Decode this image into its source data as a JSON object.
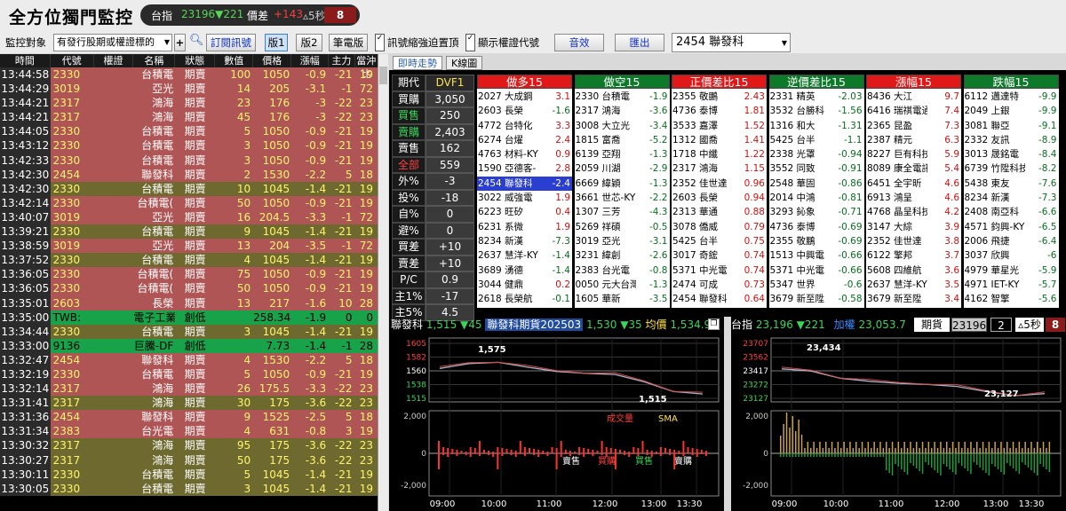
{
  "app_title": "全方位獨門監控",
  "index_pill": {
    "label": "台指",
    "value": "23196▼221",
    "spread_label": "價差",
    "spread": "+143",
    "interval": "5秒",
    "countdown": "8"
  },
  "toolbar": {
    "monitor_label": "監控對象",
    "monitor_select": "有發行股期或權證標的",
    "subscribe": "訂閱訊號",
    "v1": "版1",
    "v2": "版2",
    "notebook": "筆電版",
    "chk1": "訊號縮強迫置頂",
    "chk2": "顯示權證代號",
    "sound": "音效",
    "export": "匯出",
    "stock_select": "2454 聯發科"
  },
  "table": {
    "headers": [
      "時間",
      "代號",
      "權證",
      "名稱",
      "狀態",
      "數值",
      "價格",
      "漲幅",
      "主力",
      "當沖比"
    ],
    "rows": [
      {
        "t": "13:44:58",
        "code": "2330",
        "rt": "",
        "name": "台積電",
        "st": "期賣",
        "qty": "100",
        "pr": "1050",
        "ch": "-0.9",
        "mf": "-21",
        "bs": "19",
        "c": "red"
      },
      {
        "t": "13:44:29",
        "code": "3019",
        "rt": "",
        "name": "亞光",
        "st": "期賣",
        "qty": "14",
        "pr": "205",
        "ch": "-3.1",
        "mf": "-1",
        "bs": "72",
        "c": "red"
      },
      {
        "t": "13:44:21",
        "code": "2317",
        "rt": "",
        "name": "鴻海",
        "st": "期賣",
        "qty": "23",
        "pr": "176",
        "ch": "-3",
        "mf": "-22",
        "bs": "23",
        "c": "red"
      },
      {
        "t": "13:44:21",
        "code": "2317",
        "rt": "",
        "name": "鴻海",
        "st": "期賣",
        "qty": "45",
        "pr": "176",
        "ch": "-3",
        "mf": "-22",
        "bs": "23",
        "c": "red"
      },
      {
        "t": "13:44:05",
        "code": "2330",
        "rt": "",
        "name": "台積電",
        "st": "期賣",
        "qty": "5",
        "pr": "1050",
        "ch": "-0.9",
        "mf": "-21",
        "bs": "19",
        "c": "red"
      },
      {
        "t": "13:43:12",
        "code": "2330",
        "rt": "",
        "name": "台積電",
        "st": "期賣",
        "qty": "3",
        "pr": "1050",
        "ch": "-0.9",
        "mf": "-21",
        "bs": "19",
        "c": "red"
      },
      {
        "t": "13:42:33",
        "code": "2330",
        "rt": "",
        "name": "台積電",
        "st": "期賣",
        "qty": "3",
        "pr": "1050",
        "ch": "-0.9",
        "mf": "-21",
        "bs": "19",
        "c": "red"
      },
      {
        "t": "13:42:30",
        "code": "2454",
        "rt": "",
        "name": "聯發科",
        "st": "期賣",
        "qty": "2",
        "pr": "1530",
        "ch": "-2.2",
        "mf": "5",
        "bs": "18",
        "c": "red"
      },
      {
        "t": "13:42:30",
        "code": "2330",
        "rt": "",
        "name": "台積電",
        "st": "期賣",
        "qty": "10",
        "pr": "1045",
        "ch": "-1.4",
        "mf": "-21",
        "bs": "19",
        "c": "olive"
      },
      {
        "t": "13:42:14",
        "code": "2330",
        "rt": "",
        "name": "台積電(",
        "st": "期賣",
        "qty": "50",
        "pr": "1050",
        "ch": "-0.9",
        "mf": "-21",
        "bs": "19",
        "c": "red"
      },
      {
        "t": "13:40:07",
        "code": "3019",
        "rt": "",
        "name": "亞光",
        "st": "期賣",
        "qty": "16",
        "pr": "204.5",
        "ch": "-3.3",
        "mf": "-1",
        "bs": "72",
        "c": "red"
      },
      {
        "t": "13:39:21",
        "code": "2330",
        "rt": "",
        "name": "台積電",
        "st": "期賣",
        "qty": "9",
        "pr": "1045",
        "ch": "-1.4",
        "mf": "-21",
        "bs": "19",
        "c": "olive"
      },
      {
        "t": "13:38:59",
        "code": "3019",
        "rt": "",
        "name": "亞光",
        "st": "期賣",
        "qty": "13",
        "pr": "204",
        "ch": "-3.5",
        "mf": "-1",
        "bs": "72",
        "c": "red"
      },
      {
        "t": "13:37:52",
        "code": "2330",
        "rt": "",
        "name": "台積電",
        "st": "期賣",
        "qty": "4",
        "pr": "1045",
        "ch": "-1.4",
        "mf": "-21",
        "bs": "19",
        "c": "olive"
      },
      {
        "t": "13:36:05",
        "code": "2330",
        "rt": "",
        "name": "台積電(",
        "st": "期賣",
        "qty": "75",
        "pr": "1050",
        "ch": "-0.9",
        "mf": "-21",
        "bs": "19",
        "c": "red"
      },
      {
        "t": "13:36:05",
        "code": "2330",
        "rt": "",
        "name": "台積電(",
        "st": "期賣",
        "qty": "50",
        "pr": "1050",
        "ch": "-0.9",
        "mf": "-21",
        "bs": "19",
        "c": "red"
      },
      {
        "t": "13:35:01",
        "code": "2603",
        "rt": "",
        "name": "長榮",
        "st": "期賣",
        "qty": "13",
        "pr": "217",
        "ch": "-1.6",
        "mf": "10",
        "bs": "28",
        "c": "red"
      },
      {
        "t": "13:35:00",
        "code": "TWB:",
        "rt": "",
        "name": "電子工業",
        "st": "創低",
        "qty": "",
        "pr": "258.34",
        "ch": "-1.9",
        "mf": "0",
        "bs": "0",
        "c": "green"
      },
      {
        "t": "13:34:44",
        "code": "2330",
        "rt": "",
        "name": "台積電",
        "st": "期賣",
        "qty": "3",
        "pr": "1045",
        "ch": "-1.4",
        "mf": "-21",
        "bs": "19",
        "c": "olive"
      },
      {
        "t": "13:33:00",
        "code": "9136",
        "rt": "",
        "name": "巨騰-DF",
        "st": "創低",
        "qty": "",
        "pr": "7.73",
        "ch": "-1.4",
        "mf": "-1",
        "bs": "28",
        "c": "green"
      },
      {
        "t": "13:32:47",
        "code": "2454",
        "rt": "",
        "name": "聯發科",
        "st": "期賣",
        "qty": "4",
        "pr": "1530",
        "ch": "-2.2",
        "mf": "5",
        "bs": "18",
        "c": "red"
      },
      {
        "t": "13:32:19",
        "code": "2330",
        "rt": "",
        "name": "台積電",
        "st": "期賣",
        "qty": "5",
        "pr": "1050",
        "ch": "-0.9",
        "mf": "-21",
        "bs": "19",
        "c": "red"
      },
      {
        "t": "13:32:14",
        "code": "2317",
        "rt": "",
        "name": "鴻海",
        "st": "期賣",
        "qty": "26",
        "pr": "175.5",
        "ch": "-3.3",
        "mf": "-22",
        "bs": "23",
        "c": "red"
      },
      {
        "t": "13:31:41",
        "code": "2317",
        "rt": "",
        "name": "鴻海",
        "st": "期賣",
        "qty": "30",
        "pr": "175",
        "ch": "-3.6",
        "mf": "-22",
        "bs": "23",
        "c": "olive"
      },
      {
        "t": "13:31:36",
        "code": "2454",
        "rt": "",
        "name": "聯發科",
        "st": "期賣",
        "qty": "9",
        "pr": "1525",
        "ch": "-2.5",
        "mf": "5",
        "bs": "18",
        "c": "red"
      },
      {
        "t": "13:31:34",
        "code": "2383",
        "rt": "",
        "name": "台光電",
        "st": "期賣",
        "qty": "4",
        "pr": "631",
        "ch": "-0.8",
        "mf": "3",
        "bs": "19",
        "c": "red"
      },
      {
        "t": "13:30:32",
        "code": "2317",
        "rt": "",
        "name": "鴻海",
        "st": "期賣",
        "qty": "95",
        "pr": "175",
        "ch": "-3.6",
        "mf": "-22",
        "bs": "23",
        "c": "olive"
      },
      {
        "t": "13:30:27",
        "code": "2317",
        "rt": "",
        "name": "鴻海",
        "st": "期賣",
        "qty": "50",
        "pr": "175",
        "ch": "-3.6",
        "mf": "-22",
        "bs": "23",
        "c": "olive"
      },
      {
        "t": "13:30:11",
        "code": "2330",
        "rt": "",
        "name": "台積電",
        "st": "期賣",
        "qty": "5",
        "pr": "1045",
        "ch": "-1.4",
        "mf": "-21",
        "bs": "19",
        "c": "olive"
      },
      {
        "t": "13:30:05",
        "code": "2330",
        "rt": "",
        "name": "台積電",
        "st": "期賣",
        "qty": "3",
        "pr": "1045",
        "ch": "-1.4",
        "mf": "-21",
        "bs": "19",
        "c": "olive"
      }
    ]
  },
  "tabs": [
    "即時走勢",
    "K線圖"
  ],
  "metrics": [
    {
      "l": "期代",
      "v": "DVF1",
      "lc": "#fff",
      "vc": "#ffe24a"
    },
    {
      "l": "買購",
      "v": "3,050",
      "lc": "#fff",
      "vc": "#fff"
    },
    {
      "l": "買售",
      "v": "250",
      "lc": "#3bd45a",
      "vc": "#fff"
    },
    {
      "l": "賣購",
      "v": "2,403",
      "lc": "#3bd45a",
      "vc": "#fff"
    },
    {
      "l": "賣售",
      "v": "162",
      "lc": "#fff",
      "vc": "#fff"
    },
    {
      "l": "全部",
      "v": "559",
      "lc": "#ff4040",
      "vc": "#fff"
    },
    {
      "l": "外%",
      "v": "-3",
      "lc": "#fff",
      "vc": "#fff"
    },
    {
      "l": "投%",
      "v": "-18",
      "lc": "#fff",
      "vc": "#fff"
    },
    {
      "l": "自%",
      "v": "0",
      "lc": "#fff",
      "vc": "#fff"
    },
    {
      "l": "避%",
      "v": "0",
      "lc": "#fff",
      "vc": "#fff"
    },
    {
      "l": "買差",
      "v": "+10",
      "lc": "#fff",
      "vc": "#fff"
    },
    {
      "l": "賣差",
      "v": "+10",
      "lc": "#fff",
      "vc": "#fff"
    },
    {
      "l": "P/C",
      "v": "0.9",
      "lc": "#fff",
      "vc": "#fff"
    },
    {
      "l": "主1%",
      "v": "-17",
      "lc": "#fff",
      "vc": "#fff"
    },
    {
      "l": "主5%",
      "v": "4.5",
      "lc": "#fff",
      "vc": "#fff"
    }
  ],
  "rankings": [
    {
      "title": "做多15",
      "hc": "#e01818",
      "rows": [
        [
          "2027 大成鋼",
          "3.1"
        ],
        [
          "2603 長榮",
          "-1.6"
        ],
        [
          "4772 台特化",
          "3.3"
        ],
        [
          "6274 台燿",
          "2.4"
        ],
        [
          "4763 材料-KY",
          "0.9"
        ],
        [
          "1590 亞德客-",
          "2.8"
        ],
        [
          "2454 聯發科",
          "-2.4"
        ],
        [
          "3022 威強電",
          "1.9"
        ],
        [
          "6223 旺矽",
          "0.4"
        ],
        [
          "6231 系微",
          "1.9"
        ],
        [
          "8234 新漢",
          "-7.3"
        ],
        [
          "2637 慧洋-KY",
          "-1.4"
        ],
        [
          "3689 湧德",
          "-1.4"
        ],
        [
          "3044 健鼎",
          "0.2"
        ],
        [
          "2618 長榮航",
          "-0.1"
        ]
      ],
      "sel": 6
    },
    {
      "title": "做空15",
      "hc": "#0d7a2a",
      "rows": [
        [
          "2330 台積電",
          "-1.9"
        ],
        [
          "2317 鴻海",
          "-3.6"
        ],
        [
          "3008 大立光",
          "-3.4"
        ],
        [
          "1815 富喬",
          "-5.2"
        ],
        [
          "6139 亞翔",
          "-1.3"
        ],
        [
          "2059 川湖",
          "-2.9"
        ],
        [
          "6669 緯穎",
          "-1.3"
        ],
        [
          "3661 世芯-KY",
          "-2.2"
        ],
        [
          "1307 三芳",
          "-4.3"
        ],
        [
          "5269 祥碩",
          "-0.5"
        ],
        [
          "3019 亞光",
          "-3.1"
        ],
        [
          "3231 緯創",
          "-2.6"
        ],
        [
          "2383 台光電",
          "-0.8"
        ],
        [
          "0050 元大台灣",
          "-1.3"
        ],
        [
          "1605 華新",
          "-3.5"
        ]
      ],
      "sel": -1
    },
    {
      "title": "正價差比15",
      "hc": "#e01818",
      "rows": [
        [
          "2355 敬鵬",
          "2.43"
        ],
        [
          "4736 泰博",
          "1.81"
        ],
        [
          "3533 嘉澤",
          "1.52"
        ],
        [
          "1312 國喬",
          "1.41"
        ],
        [
          "1718 中纖",
          "1.22"
        ],
        [
          "2317 鴻海",
          "1.15"
        ],
        [
          "2352 佳世達",
          "0.96"
        ],
        [
          "2603 長榮",
          "0.94"
        ],
        [
          "2313 華通",
          "0.88"
        ],
        [
          "3078 僑威",
          "0.79"
        ],
        [
          "5425 台半",
          "0.75"
        ],
        [
          "3017 奇鋐",
          "0.74"
        ],
        [
          "5371 中光電",
          "0.74"
        ],
        [
          "2474 可成",
          "0.73"
        ],
        [
          "2454 聯發科",
          "0.64"
        ]
      ],
      "sel": -1
    },
    {
      "title": "逆價差比15",
      "hc": "#0d7a2a",
      "rows": [
        [
          "2331 精英",
          "-2.03"
        ],
        [
          "3532 台勝科",
          "-1.56"
        ],
        [
          "1316 和大",
          "-1.31"
        ],
        [
          "5425 台半",
          "-1.1"
        ],
        [
          "2338 光罩",
          "-0.94"
        ],
        [
          "3552 同致",
          "-0.91"
        ],
        [
          "2548 華固",
          "-0.86"
        ],
        [
          "2014 中鴻",
          "-0.81"
        ],
        [
          "3293 鈊象",
          "-0.71"
        ],
        [
          "4736 泰博",
          "-0.69"
        ],
        [
          "2355 敬鵬",
          "-0.69"
        ],
        [
          "1513 中興電",
          "-0.66"
        ],
        [
          "5371 中光電",
          "-0.66"
        ],
        [
          "5347 世界",
          "-0.6"
        ],
        [
          "3679 新至陞",
          "-0.58"
        ]
      ],
      "sel": -1
    },
    {
      "title": "漲幅15",
      "hc": "#e01818",
      "rows": [
        [
          "8436 大江",
          "9.7"
        ],
        [
          "6416 瑞祺電通",
          "7.4"
        ],
        [
          "2365 昆盈",
          "7.3"
        ],
        [
          "2387 精元",
          "6.3"
        ],
        [
          "8227 巨有科技",
          "5.9"
        ],
        [
          "8089 康全電訊",
          "5.4"
        ],
        [
          "6451 全宇昕",
          "4.6"
        ],
        [
          "6913 鴻呈",
          "4.6"
        ],
        [
          "4768 晶呈科技",
          "4.2"
        ],
        [
          "3147 大綜",
          "3.9"
        ],
        [
          "2352 佳世達",
          "3.8"
        ],
        [
          "6122 擎邦",
          "3.7"
        ],
        [
          "5608 四維航",
          "3.6"
        ],
        [
          "2637 慧洋-KY",
          "3.5"
        ],
        [
          "3679 新至陞",
          "3.4"
        ]
      ],
      "sel": -1
    },
    {
      "title": "跌幅15",
      "hc": "#0d7a2a",
      "rows": [
        [
          "6112 邁達特",
          "-9.9"
        ],
        [
          "2049 上銀",
          "-9.9"
        ],
        [
          "3081 聯亞",
          "-9.1"
        ],
        [
          "2332 友訊",
          "-8.9"
        ],
        [
          "3013 晟銘電",
          "-8.4"
        ],
        [
          "6739 竹陞科技",
          "-8.2"
        ],
        [
          "5438 東友",
          "-7.6"
        ],
        [
          "8234 新漢",
          "-7.3"
        ],
        [
          "2408 南亞科",
          "-6.6"
        ],
        [
          "4571 鈞興-KY",
          "-6.5"
        ],
        [
          "2006 飛捷",
          "-6.4"
        ],
        [
          "3037 欣興",
          "-6"
        ],
        [
          "4979 華星光",
          "-5.9"
        ],
        [
          "4971 IET-KY",
          "-5.7"
        ],
        [
          "4162 智擎",
          "-5.6"
        ]
      ],
      "sel": -1
    }
  ],
  "chart_left": {
    "hdr": {
      "name": "聯發科",
      "price": "1,515",
      "chg": "▼45",
      "fut": "聯發科期貨202503",
      "fprice": "1,530",
      "fchg": "▼35",
      "avg_label": "均價",
      "avg": "1,534.92"
    },
    "yticks": [
      "1605",
      "1582",
      "1560",
      "1538",
      "1515"
    ],
    "vol_ticks": [
      "2,000",
      "0",
      "-2,000"
    ],
    "xticks": [
      "09:00",
      "10:00",
      "11:00",
      "12:00",
      "13:00",
      "13:30"
    ],
    "hi_label": "1,575",
    "lo_label": "1,515",
    "sma": "SMA",
    "trade_vol": "成交量",
    "legend": [
      "賣售",
      "買購",
      "買售",
      "賣購"
    ]
  },
  "chart_right": {
    "hdr": {
      "name": "台指",
      "value": "23,196",
      "chg": "▼221",
      "weight_label": "加權",
      "weight": "23,053.7",
      "fut_label": "期貨",
      "fut": "23196",
      "small": "2",
      "interval": "5秒",
      "cd": "8"
    },
    "yticks": [
      "23707",
      "23562",
      "23417",
      "23272",
      "23127"
    ],
    "vol_ticks": [
      "2,000",
      "0",
      "-2,000"
    ],
    "xticks": [
      "09:00",
      "10:00",
      "11:00",
      "12:00",
      "13:00",
      "13:30"
    ],
    "hi_label": "23,434",
    "lo_label": "23,127"
  },
  "chart_data": [
    {
      "type": "line",
      "title": "聯發科",
      "x": [
        "09:00",
        "09:30",
        "10:00",
        "10:30",
        "11:00",
        "11:30",
        "12:00",
        "12:30",
        "13:00",
        "13:30"
      ],
      "series": [
        {
          "name": "聯發科",
          "values": [
            1560,
            1568,
            1570,
            1562,
            1555,
            1552,
            1550,
            1538,
            1522,
            1518
          ]
        }
      ],
      "ylim": [
        1505,
        1610
      ]
    },
    {
      "type": "line",
      "title": "台指",
      "x": [
        "09:00",
        "09:30",
        "10:00",
        "10:30",
        "11:00",
        "11:30",
        "12:00",
        "12:30",
        "13:00",
        "13:30"
      ],
      "series": [
        {
          "name": "台指",
          "values": [
            23420,
            23400,
            23330,
            23300,
            23280,
            23270,
            23250,
            23200,
            23160,
            23180
          ]
        }
      ],
      "ylim": [
        23100,
        23720
      ]
    }
  ]
}
